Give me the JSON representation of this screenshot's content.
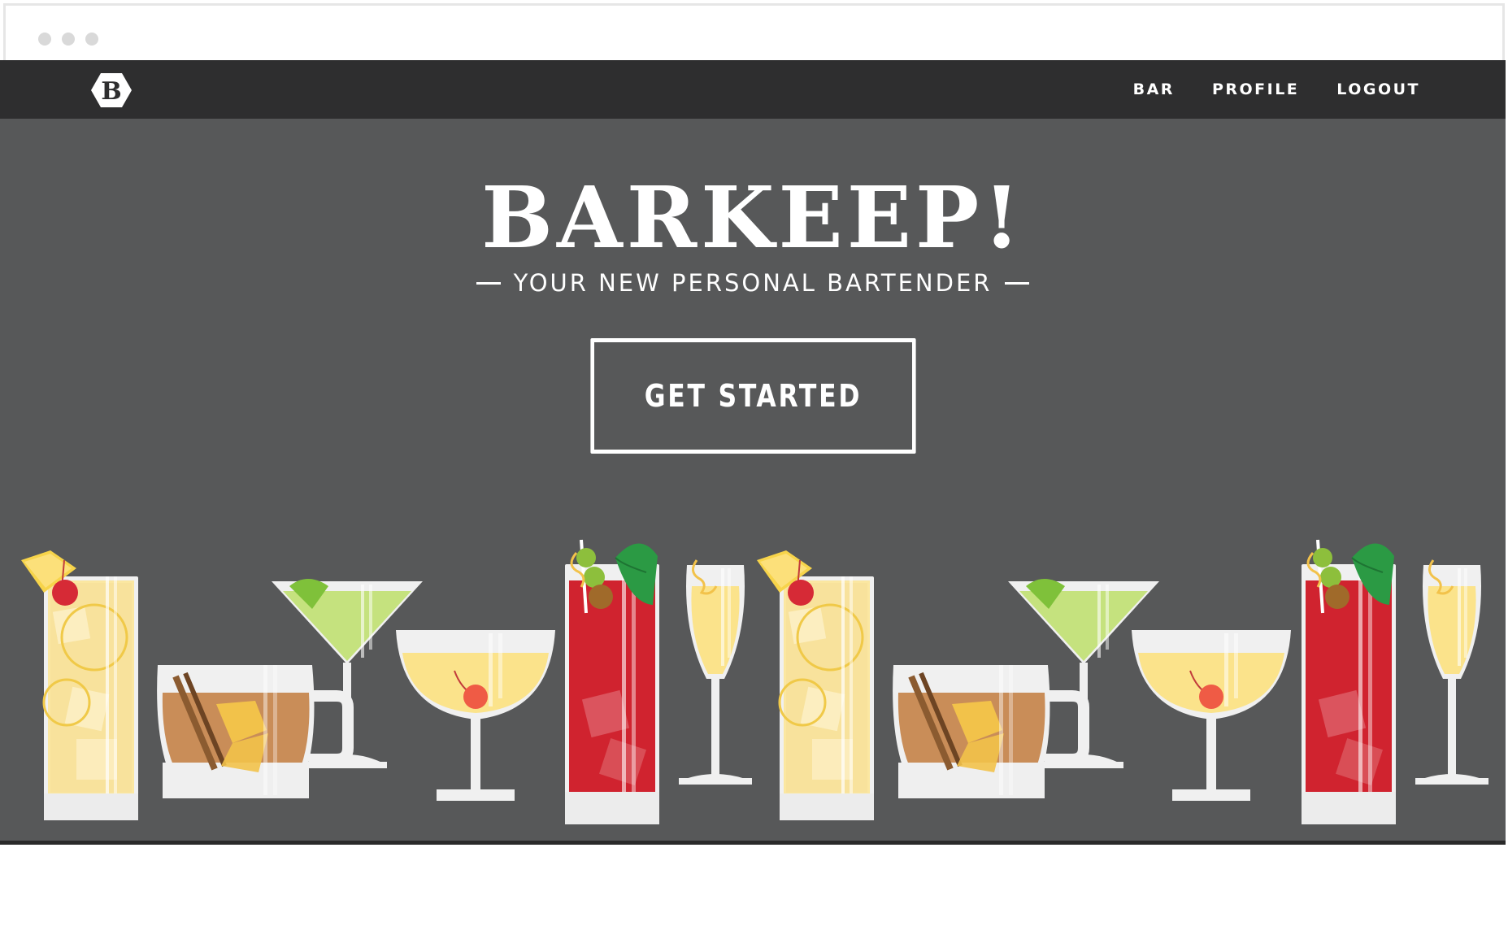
{
  "nav": {
    "links": [
      "BAR",
      "PROFILE",
      "LOGOUT"
    ]
  },
  "hero": {
    "title": "BARKEEP!",
    "subtitle": "YOUR NEW PERSONAL BARTENDER",
    "cta_label": "GET STARTED"
  },
  "colors": {
    "navbar": "#2e2e2f",
    "hero_bg": "#575859",
    "text": "#ffffff"
  }
}
